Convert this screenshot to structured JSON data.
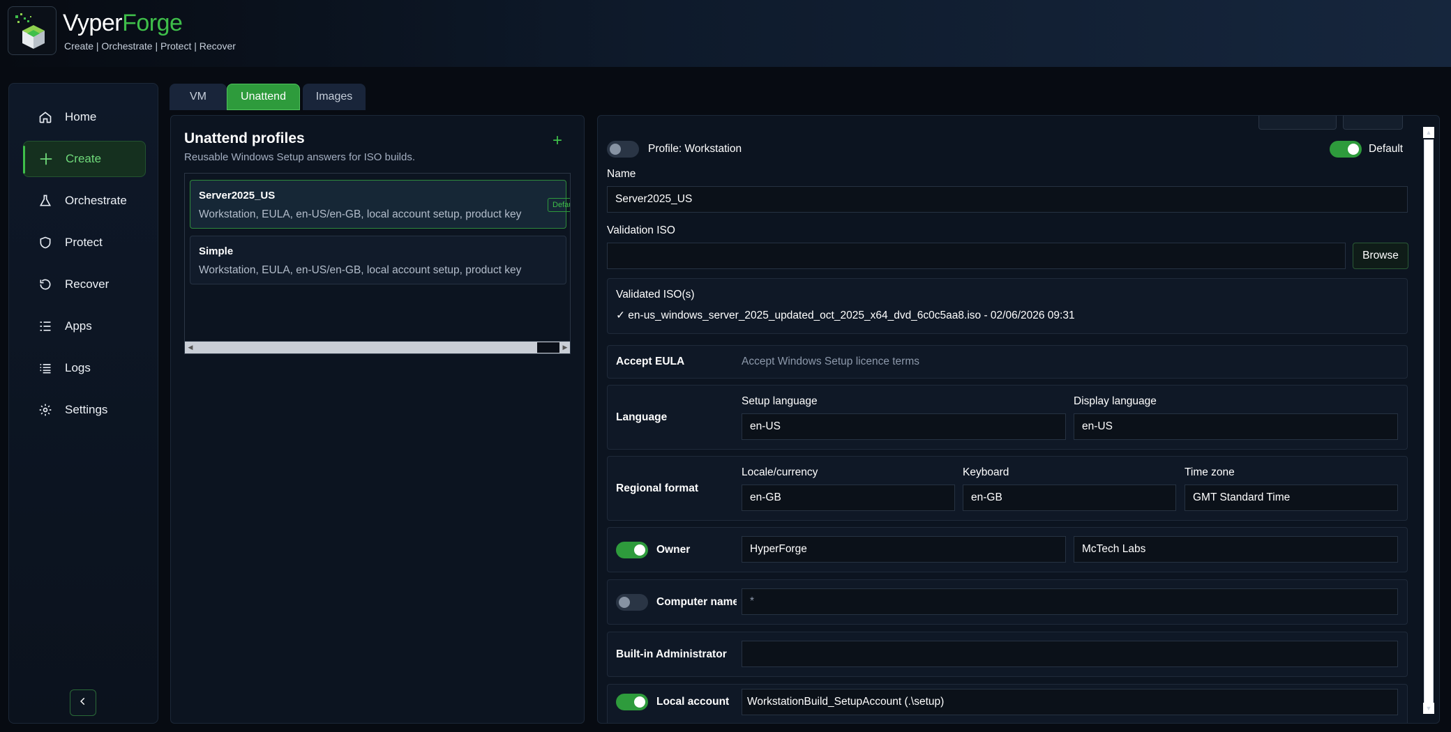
{
  "app": {
    "brand_part1": "Vyper",
    "brand_part2": "Forge",
    "tagline": "Create | Orchestrate | Protect | Recover",
    "accent_color": "#3fbf4a"
  },
  "sidebar": {
    "items": [
      {
        "label": "Home",
        "icon": "home-icon"
      },
      {
        "label": "Create",
        "icon": "plus-icon"
      },
      {
        "label": "Orchestrate",
        "icon": "flask-icon"
      },
      {
        "label": "Protect",
        "icon": "shield-icon"
      },
      {
        "label": "Recover",
        "icon": "restore-icon"
      },
      {
        "label": "Apps",
        "icon": "list-icon"
      },
      {
        "label": "Logs",
        "icon": "logs-icon"
      },
      {
        "label": "Settings",
        "icon": "gear-icon"
      }
    ],
    "active": "Create",
    "collapse_icon": "chevron-left-icon"
  },
  "tabs": [
    {
      "label": "VM",
      "active": false
    },
    {
      "label": "Unattend",
      "active": true
    },
    {
      "label": "Images",
      "active": false
    }
  ],
  "profiles_panel": {
    "title": "Unattend profiles",
    "subtitle": "Reusable Windows Setup answers for ISO builds.",
    "add_label": "+",
    "profiles": [
      {
        "name": "Server2025_US",
        "description": "Workstation, EULA, en-US/en-GB, local account setup, product key",
        "badge": "Default",
        "selected": true
      },
      {
        "name": "Simple",
        "description": "Workstation, EULA, en-US/en-GB, local account setup, product key",
        "selected": false
      }
    ]
  },
  "editor": {
    "profile_label": "Profile: Workstation",
    "profile_toggle": false,
    "default_label": "Default",
    "default_toggle": true,
    "name_label": "Name",
    "name_value": "Server2025_US",
    "validation_iso_label": "Validation ISO",
    "validation_iso_value": "",
    "browse_label": "Browse",
    "validated_title": "Validated ISO(s)",
    "validated_entry": "✓ en-us_windows_server_2025_updated_oct_2025_x64_dvd_6c0c5aa8.iso - 02/06/2026 09:31",
    "eula_label": "Accept EULA",
    "eula_desc": "Accept Windows Setup licence terms",
    "language": {
      "label": "Language",
      "setup_label": "Setup language",
      "setup_value": "en-US",
      "display_label": "Display language",
      "display_value": "en-US"
    },
    "regional": {
      "label": "Regional format",
      "locale_label": "Locale/currency",
      "locale_value": "en-GB",
      "keyboard_label": "Keyboard",
      "keyboard_value": "en-GB",
      "timezone_label": "Time zone",
      "timezone_value": "GMT Standard Time"
    },
    "owner": {
      "label": "Owner",
      "enabled": true,
      "name_value": "HyperForge",
      "org_value": "McTech Labs"
    },
    "computer_name": {
      "label": "Computer name",
      "enabled": false,
      "value": "*"
    },
    "builtin_admin": {
      "label": "Built-in Administrator",
      "value": ""
    },
    "local_account": {
      "label": "Local account",
      "enabled": true,
      "value": "WorkstationBuild_SetupAccount (.\\setup)"
    }
  }
}
